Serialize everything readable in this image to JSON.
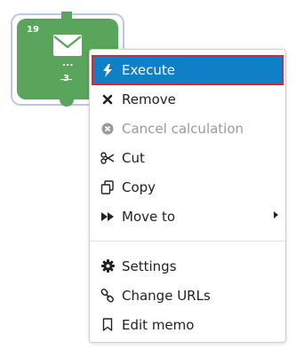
{
  "node": {
    "number": "19",
    "ellipsis": "...",
    "count": "3",
    "color": "#5aa55c",
    "icon": "envelope-icon"
  },
  "menu": {
    "items": [
      {
        "label": "Execute",
        "icon": "lightning-icon",
        "state": "highlighted"
      },
      {
        "label": "Remove",
        "icon": "close-x-icon",
        "state": "enabled"
      },
      {
        "label": "Cancel calculation",
        "icon": "cancel-circle-icon",
        "state": "disabled"
      },
      {
        "label": "Cut",
        "icon": "scissors-icon",
        "state": "enabled"
      },
      {
        "label": "Copy",
        "icon": "copy-icon",
        "state": "enabled"
      },
      {
        "label": "Move to",
        "icon": "fast-forward-icon",
        "state": "enabled",
        "has_submenu": true
      },
      {
        "label": "Settings",
        "icon": "gear-icon",
        "state": "enabled"
      },
      {
        "label": "Change URLs",
        "icon": "link-icon",
        "state": "enabled"
      },
      {
        "label": "Edit memo",
        "icon": "bookmark-icon",
        "state": "enabled"
      }
    ],
    "highlight_color": "#0f7fc8",
    "focus_outline_color": "#e0242b"
  }
}
